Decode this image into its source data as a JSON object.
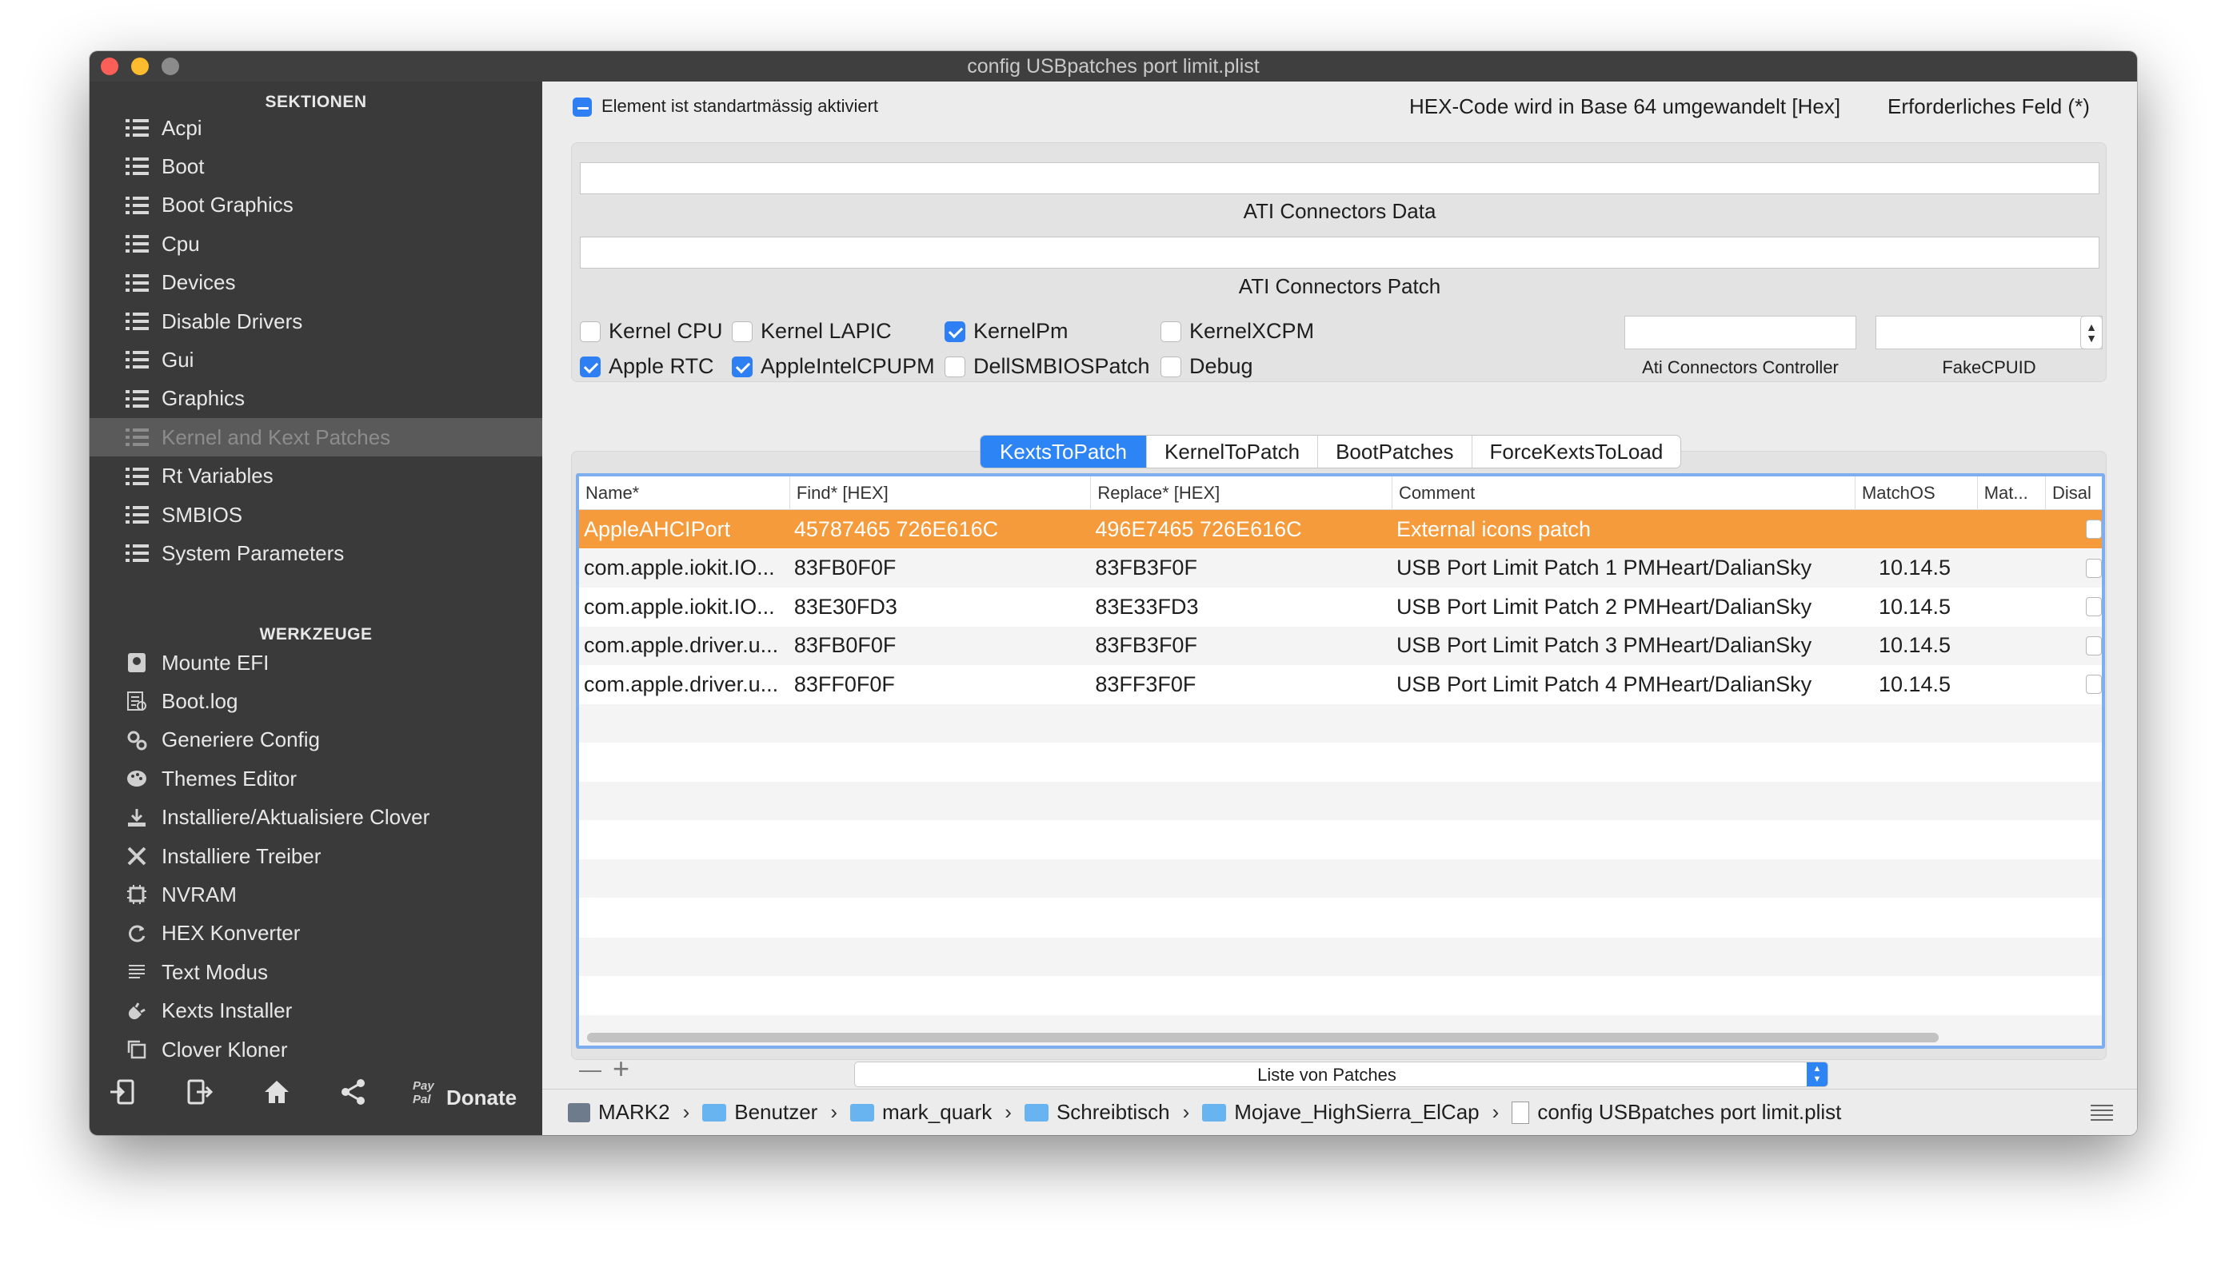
{
  "window": {
    "title": "config USBpatches port limit.plist"
  },
  "sidebar": {
    "section_header": "SEKTIONEN",
    "sections": [
      {
        "label": "Acpi",
        "icon": "list-icon"
      },
      {
        "label": "Boot",
        "icon": "list-icon"
      },
      {
        "label": "Boot Graphics",
        "icon": "list-icon"
      },
      {
        "label": "Cpu",
        "icon": "list-icon"
      },
      {
        "label": "Devices",
        "icon": "list-icon"
      },
      {
        "label": "Disable Drivers",
        "icon": "list-icon"
      },
      {
        "label": "Gui",
        "icon": "list-icon"
      },
      {
        "label": "Graphics",
        "icon": "list-icon"
      },
      {
        "label": "Kernel and Kext Patches",
        "icon": "list-icon",
        "selected": true
      },
      {
        "label": "Rt Variables",
        "icon": "list-icon"
      },
      {
        "label": "SMBIOS",
        "icon": "list-icon"
      },
      {
        "label": "System Parameters",
        "icon": "list-icon"
      }
    ],
    "tools_header": "WERKZEUGE",
    "tools": [
      {
        "label": "Mounte EFI",
        "icon": "disk-icon"
      },
      {
        "label": "Boot.log",
        "icon": "log-icon"
      },
      {
        "label": "Generiere Config",
        "icon": "gears-icon"
      },
      {
        "label": "Themes Editor",
        "icon": "palette-icon"
      },
      {
        "label": "Installiere/Aktualisiere Clover",
        "icon": "download-icon"
      },
      {
        "label": "Installiere Treiber",
        "icon": "tools-icon"
      },
      {
        "label": "NVRAM",
        "icon": "chip-icon"
      },
      {
        "label": "HEX Konverter",
        "icon": "refresh-icon"
      },
      {
        "label": "Text Modus",
        "icon": "text-icon"
      },
      {
        "label": "Kexts Installer",
        "icon": "plug-icon"
      },
      {
        "label": "Clover Kloner",
        "icon": "clone-icon"
      }
    ],
    "donate_label": "Donate",
    "paypal_label": "Pay Pal"
  },
  "topbar": {
    "default_enabled_label": "Element ist standartmässig aktiviert",
    "hex_note": "HEX-Code wird in Base 64 umgewandelt [Hex]",
    "required_note": "Erforderliches Feld (*)"
  },
  "kernel_panel": {
    "ati_data_value": "",
    "ati_data_label": "ATI Connectors Data",
    "ati_patch_value": "",
    "ati_patch_label": "ATI Connectors Patch",
    "checkboxes": [
      {
        "label": "Kernel CPU",
        "checked": false
      },
      {
        "label": "Kernel LAPIC",
        "checked": false
      },
      {
        "label": "KernelPm",
        "checked": true
      },
      {
        "label": "KernelXCPM",
        "checked": false
      },
      {
        "label": "Apple RTC",
        "checked": true
      },
      {
        "label": "AppleIntelCPUPM",
        "checked": true
      },
      {
        "label": "DellSMBIOSPatch",
        "checked": false
      },
      {
        "label": "Debug",
        "checked": false
      }
    ],
    "ati_controller_value": "",
    "ati_controller_label": "Ati Connectors Controller",
    "fakecpuid_value": "",
    "fakecpuid_label": "FakeCPUID"
  },
  "tabs": [
    "KextsToPatch",
    "KernelToPatch",
    "BootPatches",
    "ForceKextsToLoad"
  ],
  "active_tab": "KextsToPatch",
  "table": {
    "columns": [
      "Name*",
      "Find* [HEX]",
      "Replace* [HEX]",
      "Comment",
      "MatchOS",
      "Mat...",
      "Disal"
    ],
    "rows": [
      {
        "name": "AppleAHCIPort",
        "find": "45787465 726E616C",
        "replace": "496E7465 726E616C",
        "comment": "External icons patch",
        "matchos": "",
        "selected": true
      },
      {
        "name": "com.apple.iokit.IO...",
        "find": "83FB0F0F",
        "replace": "83FB3F0F",
        "comment": "USB Port Limit Patch 1 PMHeart/DalianSky",
        "matchos": "10.14.5"
      },
      {
        "name": "com.apple.iokit.IO...",
        "find": "83E30FD3",
        "replace": "83E33FD3",
        "comment": "USB Port Limit Patch 2 PMHeart/DalianSky",
        "matchos": "10.14.5"
      },
      {
        "name": "com.apple.driver.u...",
        "find": "83FB0F0F",
        "replace": "83FB3F0F",
        "comment": "USB Port Limit Patch 3 PMHeart/DalianSky",
        "matchos": "10.14.5"
      },
      {
        "name": "com.apple.driver.u...",
        "find": "83FF0F0F",
        "replace": "83FF3F0F",
        "comment": "USB Port Limit Patch 4 PMHeart/DalianSky",
        "matchos": "10.14.5"
      }
    ]
  },
  "footer": {
    "remove_label": "—",
    "add_label": "+",
    "patch_list_label": "Liste von Patches"
  },
  "pathbar": [
    "MARK2",
    "Benutzer",
    "mark_quark",
    "Schreibtisch",
    "Mojave_HighSierra_ElCap",
    "config USBpatches port limit.plist"
  ],
  "colors": {
    "accent": "#2d84f5",
    "selection": "#f59b3b",
    "sidebar": "#3a3a3a"
  }
}
